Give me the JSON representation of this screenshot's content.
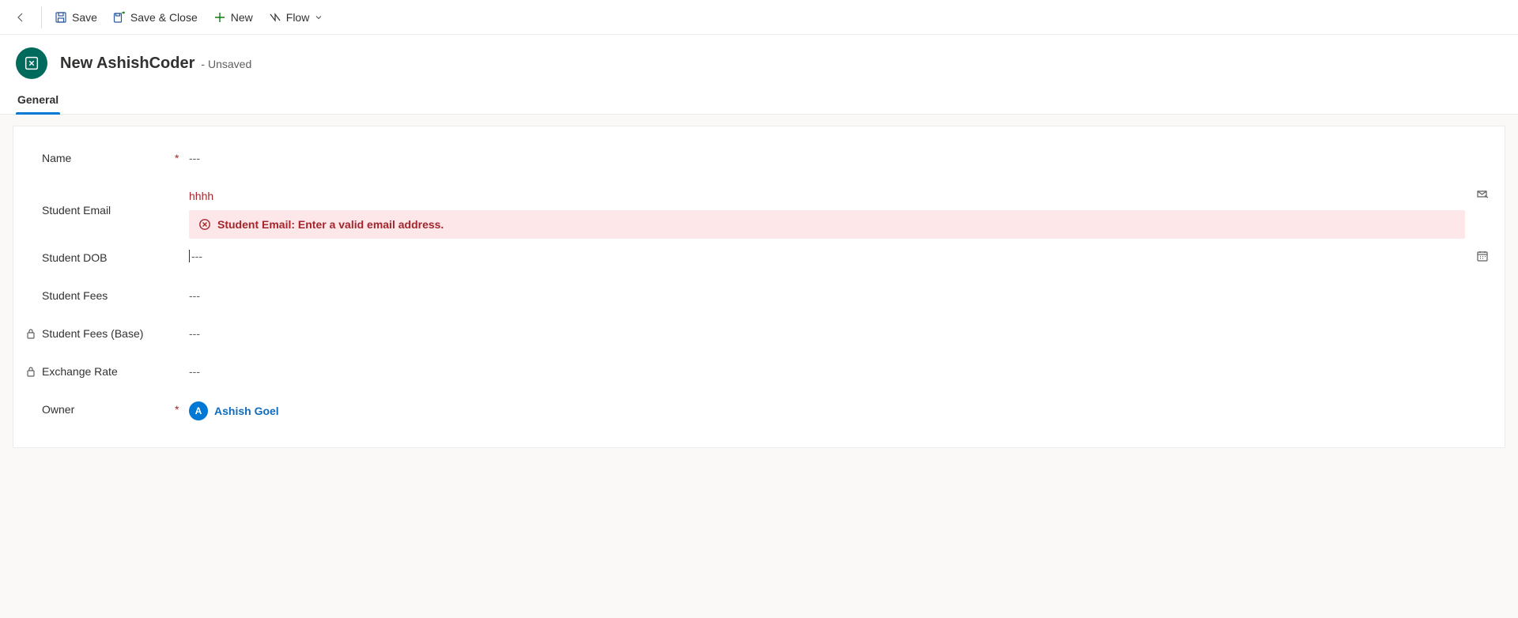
{
  "commands": {
    "save": "Save",
    "save_close": "Save & Close",
    "new": "New",
    "flow": "Flow"
  },
  "header": {
    "title": "New AshishCoder",
    "status_prefix": "- ",
    "status": "Unsaved"
  },
  "tabs": {
    "general": "General"
  },
  "fields": {
    "name": {
      "label": "Name",
      "required": "*",
      "value": "---"
    },
    "student_email": {
      "label": "Student Email",
      "value": "hhhh",
      "error": "Student Email: Enter a valid email address."
    },
    "student_dob": {
      "label": "Student DOB",
      "value": "---"
    },
    "student_fees": {
      "label": "Student Fees",
      "value": "---"
    },
    "student_fees_base": {
      "label": "Student Fees (Base)",
      "value": "---"
    },
    "exchange_rate": {
      "label": "Exchange Rate",
      "value": "---"
    },
    "owner": {
      "label": "Owner",
      "required": "*",
      "avatar_initial": "A",
      "name": "Ashish Goel"
    }
  }
}
